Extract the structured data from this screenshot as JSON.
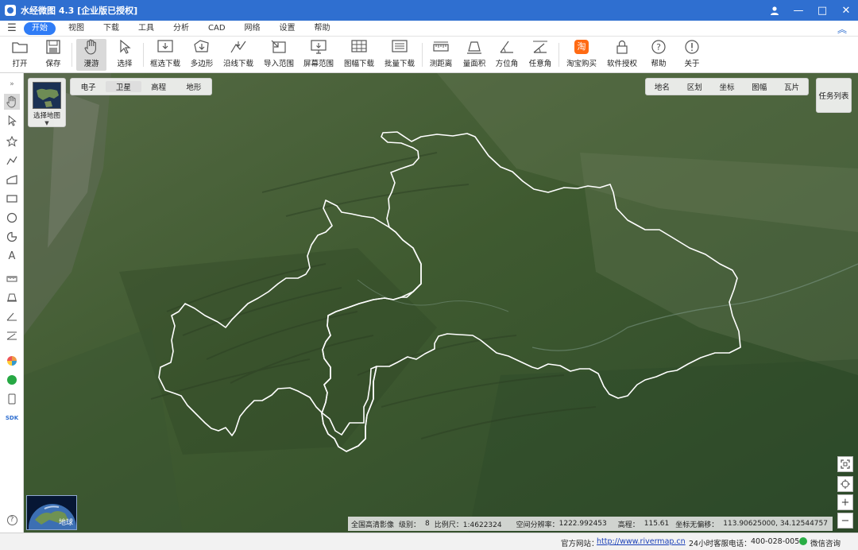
{
  "window": {
    "title": "水经微图 4.3 [企业版已授权]",
    "controls": {
      "minimize": "—",
      "maximize": "□",
      "close": "✕"
    }
  },
  "menu": {
    "items": [
      {
        "label": "开始",
        "active": true
      },
      {
        "label": "视图"
      },
      {
        "label": "下载"
      },
      {
        "label": "工具"
      },
      {
        "label": "分析"
      },
      {
        "label": "CAD"
      },
      {
        "label": "网络"
      },
      {
        "label": "设置"
      },
      {
        "label": "帮助"
      }
    ]
  },
  "toolbar": {
    "open": "打开",
    "save": "保存",
    "pan": "漫游",
    "select": "选择",
    "rect_download": "框选下载",
    "polygon": "多边形",
    "line_download": "沿线下载",
    "import_range": "导入范围",
    "screen_range": "屏幕范围",
    "sheet_download": "图幅下载",
    "batch_download": "批量下载",
    "measure_distance": "测距离",
    "measure_area": "量面积",
    "azimuth": "方位角",
    "any_angle": "任意角",
    "taobao": "淘宝购买",
    "license": "软件授权",
    "help": "帮助",
    "about": "关于"
  },
  "left_tools": [
    "expand-icon",
    "hand-icon",
    "pointer-icon",
    "star-pin-icon",
    "polyline-icon",
    "area-icon",
    "rectangle-icon",
    "circle-icon",
    "sector-icon",
    "text-icon",
    "ruler-icon",
    "layer-icon",
    "angle-icon",
    "protractor-icon",
    "globe-color-icon",
    "green-circle-icon",
    "phone-icon",
    "sdk-icon",
    "question-icon"
  ],
  "left_labels": {
    "sdk": "SDK",
    "question": "?"
  },
  "map": {
    "tabs": [
      {
        "label": "电子"
      },
      {
        "label": "卫星",
        "active": true
      },
      {
        "label": "高程"
      },
      {
        "label": "地形"
      }
    ],
    "select_map": "选择地图",
    "right_tabs": [
      "地名",
      "区划",
      "坐标",
      "图幅",
      "瓦片"
    ],
    "task_list": "任务列表",
    "globe_label": "地球",
    "status": {
      "source": "全国高清影像",
      "level_label": "级别：",
      "level": "8",
      "scale_label": "比例尺：1:4622324",
      "resolution_label": "空间分辨率：",
      "resolution": "1222.992453",
      "elevation_label": "高程：",
      "elevation": "115.61",
      "coord_label": "坐标无偏移：",
      "coord": "113.90625000, 34.12544757"
    }
  },
  "statusbar": {
    "website_label": "官方网站：",
    "website": "http://www.rivermap.cn",
    "phone_label": "24小时客服电话：",
    "phone": "400-028-0050",
    "wechat": "微信咨询"
  },
  "colors": {
    "titlebar": "#2f6fd0",
    "active_menu": "#2f7cf6",
    "map_base": "#3f5a32",
    "boundary": "#ffffff"
  }
}
